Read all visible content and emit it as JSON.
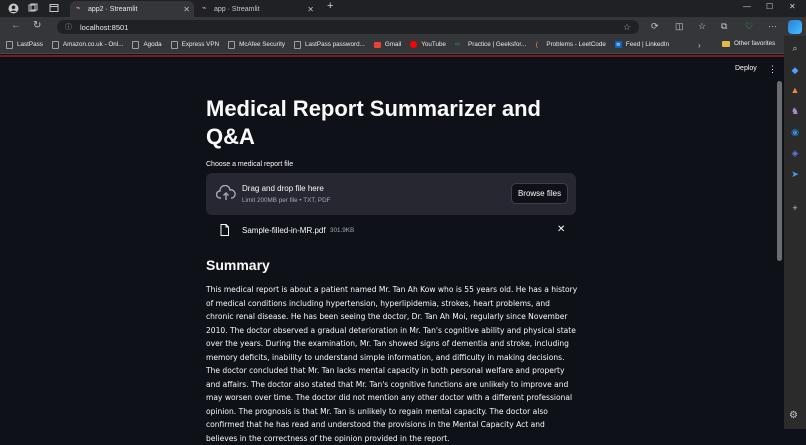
{
  "browser": {
    "tabs": [
      {
        "label": "app2 · Streamlit",
        "active": true
      },
      {
        "label": "app · Streamlit",
        "active": false
      }
    ],
    "address": "localhost:8501",
    "bookmarks": [
      "LastPass",
      "Amazon.co.uk - Onl...",
      "Agoda",
      "Express VPN",
      "McAfee Security",
      "LastPass password...",
      "Gmail",
      "YouTube",
      "Practice | Geeksfor...",
      "Problems - LeetCode",
      "Feed | LinkedIn"
    ],
    "other_bookmarks": "Other favorites"
  },
  "app": {
    "deploy_label": "Deploy",
    "title": "Medical Report Summarizer and Q&A",
    "uploader": {
      "label": "Choose a medical report file",
      "drop_title": "Drag and drop file here",
      "drop_sub": "Limit 200MB per file • TXT, PDF",
      "browse_label": "Browse files",
      "file_name": "Sample-filled-in-MR.pdf",
      "file_size": "301.9KB"
    },
    "summary_heading": "Summary",
    "summary_text": "This medical report is about a patient named Mr. Tan Ah Kow who is 55 years old. He has a history of medical conditions including hypertension, hyperlipidemia, strokes, heart problems, and chronic renal disease. He has been seeing the doctor, Dr. Tan Ah Moi, regularly since November 2010. The doctor observed a gradual deterioration in Mr. Tan's cognitive ability and physical state over the years. During the examination, Mr. Tan showed signs of dementia and stroke, including memory deficits, inability to understand simple information, and difficulty in making decisions. The doctor concluded that Mr. Tan lacks mental capacity in both personal welfare and property and affairs. The doctor also stated that Mr. Tan's cognitive functions are unlikely to improve and may worsen over time. The doctor did not mention any other doctor with a different professional opinion. The prognosis is that Mr. Tan is unlikely to regain mental capacity. The doctor also confirmed that he has read and understood the provisions in the Mental Capacity Act and believes in the correctness of the opinion provided in the report."
  },
  "colors": {
    "background": "#0e1117",
    "panel": "#262730",
    "text": "#fafafa",
    "muted": "#a3a8b8"
  }
}
